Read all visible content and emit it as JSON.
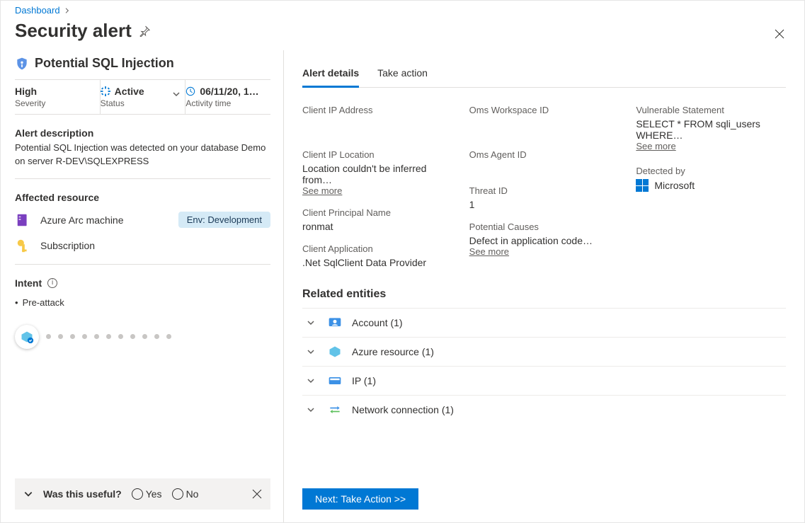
{
  "breadcrumb": {
    "root": "Dashboard"
  },
  "page_title": "Security alert",
  "alert": {
    "title": "Potential SQL Injection",
    "severity_value": "High",
    "severity_label": "Severity",
    "status_value": "Active",
    "status_label": "Status",
    "activity_value": "06/11/20, 1…",
    "activity_label": "Activity time",
    "description_header": "Alert description",
    "description_text": "Potential SQL Injection was detected on your database Demo on server R-DEV\\SQLEXPRESS",
    "affected_header": "Affected resource",
    "resources": [
      {
        "name": "Azure Arc machine",
        "tag": "Env: Development"
      },
      {
        "name": "Subscription",
        "tag": ""
      }
    ],
    "intent_header": "Intent",
    "intent_value": "Pre-attack"
  },
  "useful": {
    "question": "Was this useful?",
    "yes": "Yes",
    "no": "No"
  },
  "tabs": {
    "details": "Alert details",
    "action": "Take action"
  },
  "details": {
    "client_ip_label": "Client IP Address",
    "client_ip_value": "",
    "client_ip_loc_label": "Client IP Location",
    "client_ip_loc_value": "Location couldn't be inferred from…",
    "client_principal_label": "Client Principal Name",
    "client_principal_value": "ronmat",
    "client_app_label": "Client Application",
    "client_app_value": ".Net SqlClient Data Provider",
    "workspace_label": "Oms Workspace ID",
    "workspace_value": "",
    "agent_label": "Oms Agent ID",
    "agent_value": "",
    "threat_label": "Threat ID",
    "threat_value": "1",
    "causes_label": "Potential Causes",
    "causes_value": "Defect in application code…",
    "vuln_label": "Vulnerable Statement",
    "vuln_value": "SELECT * FROM sqli_users WHERE…",
    "detected_label": "Detected by",
    "detected_value": "Microsoft",
    "see_more": "See more"
  },
  "related": {
    "header": "Related entities",
    "items": [
      {
        "label": "Account (1)"
      },
      {
        "label": "Azure resource (1)"
      },
      {
        "label": "IP (1)"
      },
      {
        "label": "Network connection (1)"
      }
    ]
  },
  "cta_label": "Next: Take Action  >>"
}
